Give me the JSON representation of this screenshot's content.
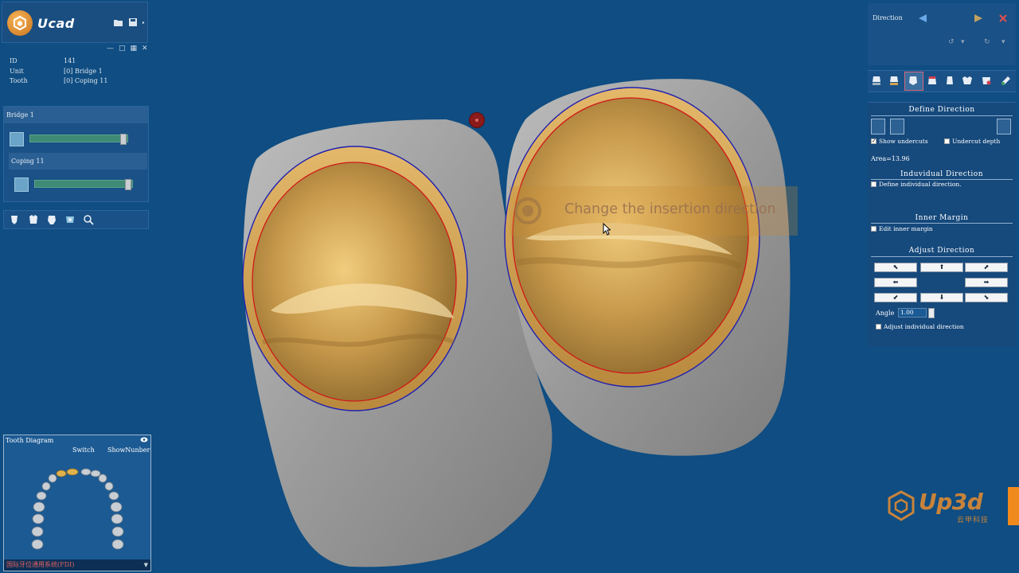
{
  "app": {
    "name": "Ucad"
  },
  "info": [
    {
      "key": "ID",
      "value": "141"
    },
    {
      "key": "Unit",
      "value": "[0] Bridge 1"
    },
    {
      "key": "Tooth",
      "value": "[0] Coping 11"
    }
  ],
  "groups": {
    "bridge_label": "Bridge 1",
    "coping_label": "Coping 11"
  },
  "tooth_diagram": {
    "title": "Tooth Diagram",
    "switch_label": "Switch",
    "show_number_label": "ShowNunber",
    "system_label": "国际牙位通用系统(FDI)"
  },
  "right": {
    "direction_label": "Direction",
    "define_direction_title": "Define Direction",
    "show_undercuts": "Show undercuts",
    "undercut_depth": "Undercut depth",
    "area_label": "Area=13.96",
    "individual_title": "Induvidual  Direction",
    "define_individual": "Define individual  direction.",
    "inner_margin_title": "Inner Margin",
    "edit_inner_margin": "Edit inner margin",
    "adjust_title": "Adjust Direction",
    "angle_label": "Angle",
    "angle_value": "1.00",
    "adjust_individual": "Adjust individual direction"
  },
  "tooltip": {
    "message": "Change the insertion direction"
  },
  "watermark": {
    "brand": "Up3d",
    "sub": "云甲科技"
  },
  "colors": {
    "background": "#0f4d82",
    "die_gray": "#a9a9a9",
    "preparation_gold": "#d6a85a",
    "margin_red": "#d01818",
    "outline_blue": "#2020b0",
    "brand_orange": "#c8833a"
  }
}
